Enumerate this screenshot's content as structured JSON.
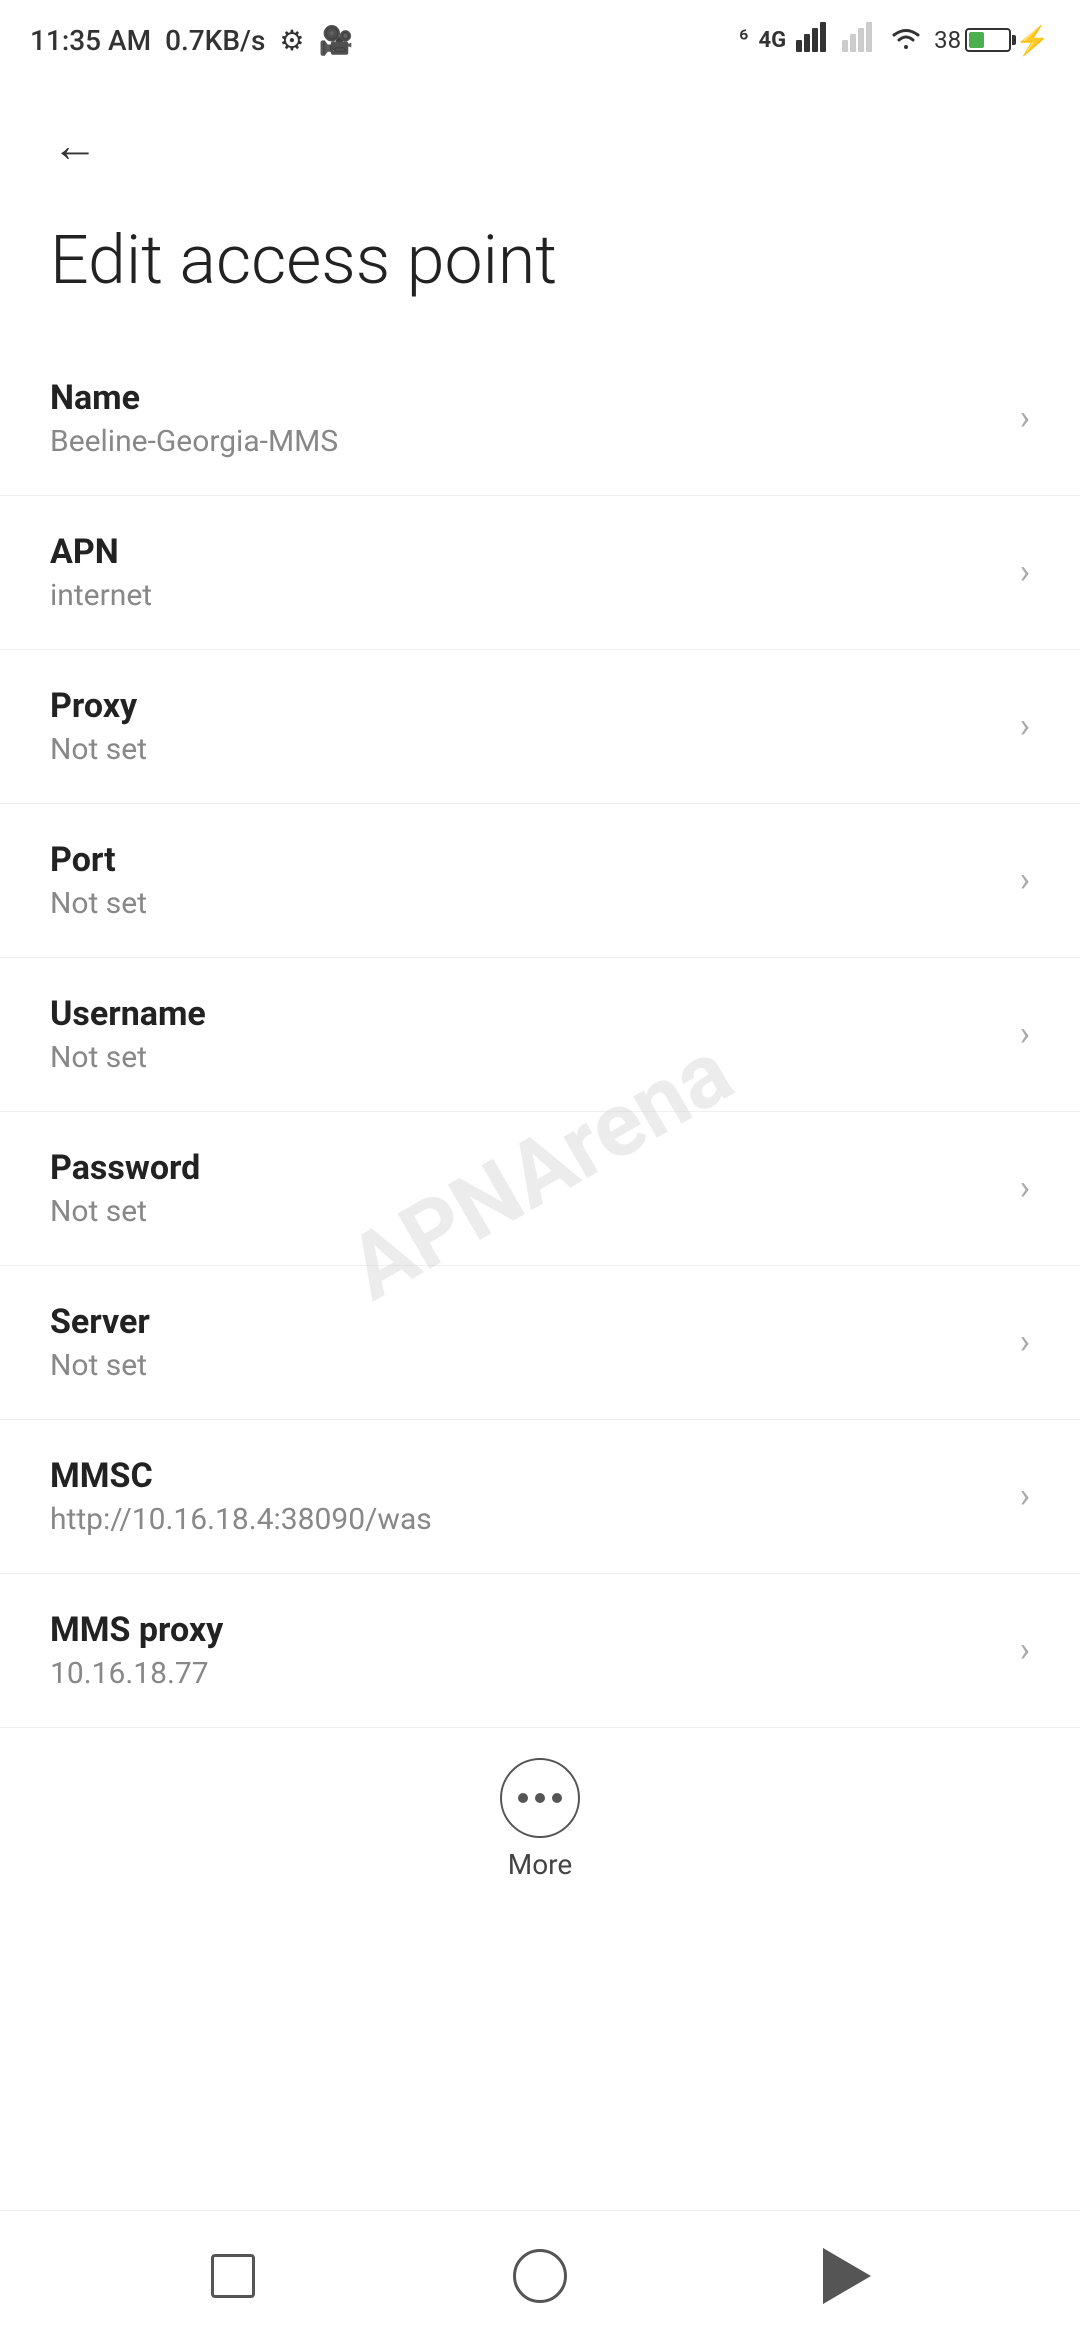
{
  "statusBar": {
    "time": "11:35 AM",
    "speed": "0.7KB/s"
  },
  "header": {
    "backLabel": "←",
    "title": "Edit access point"
  },
  "settings": {
    "items": [
      {
        "id": "name",
        "label": "Name",
        "value": "Beeline-Georgia-MMS"
      },
      {
        "id": "apn",
        "label": "APN",
        "value": "internet"
      },
      {
        "id": "proxy",
        "label": "Proxy",
        "value": "Not set"
      },
      {
        "id": "port",
        "label": "Port",
        "value": "Not set"
      },
      {
        "id": "username",
        "label": "Username",
        "value": "Not set"
      },
      {
        "id": "password",
        "label": "Password",
        "value": "Not set"
      },
      {
        "id": "server",
        "label": "Server",
        "value": "Not set"
      },
      {
        "id": "mmsc",
        "label": "MMSC",
        "value": "http://10.16.18.4:38090/was"
      },
      {
        "id": "mms-proxy",
        "label": "MMS proxy",
        "value": "10.16.18.77"
      }
    ]
  },
  "more": {
    "label": "More"
  },
  "watermark": "APNArena"
}
